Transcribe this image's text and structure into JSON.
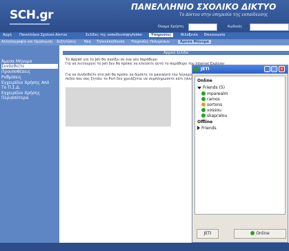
{
  "header": {
    "logo": "SCH.gr",
    "title": "ΠΑΝΕΛΛΗΝΙΟ ΣΧΟΛΙΚΟ ΔΙΚΤΥΟ",
    "subtitle": "Το Δίκτυο στην υπηρεσία της εκπαίδευσης",
    "login": {
      "username_label": "Όνομα Χρήστη",
      "password_label": "Κωδικός",
      "username_value": "",
      "password_value": ""
    }
  },
  "nav_primary": [
    {
      "label": "Αρχή"
    },
    {
      "label": "Πανελλήνιο Σχολικό Δίκτυο"
    },
    {
      "label": "Σελίδες της εκπαίδευσης"
    },
    {
      "label": "myfolder"
    },
    {
      "label": "Υπηρεσίες"
    },
    {
      "label": "Φιλοξενία"
    },
    {
      "label": "Επικοινωνία"
    }
  ],
  "nav_secondary": [
    {
      "label": "Αλληλογραφία και Οργάνωση"
    },
    {
      "label": "Συζητήσεις"
    },
    {
      "label": "Νέα"
    },
    {
      "label": "Τηλεεκπαίδευση"
    },
    {
      "label": "Υπηρεσίες Πολυμέσων"
    },
    {
      "label": "Άμεσα Μήνυμα"
    }
  ],
  "sidebar": {
    "items": [
      {
        "label": "Άμεσα Μήνυμα"
      },
      {
        "label": "Συνδεθείτε"
      },
      {
        "label": "Προυποθέσεις"
      },
      {
        "label": "Ρυθμίσεις"
      },
      {
        "label": "Εγχειρίδιο Χρήσης Από"
      },
      {
        "label": "Το Π.Σ.Δ."
      },
      {
        "label": "Εγχειρίδιο Χρήσης"
      },
      {
        "label": "Περισσότερα"
      }
    ]
  },
  "content": {
    "section_title": "Αρχική Σελίδα",
    "para1_line1": "Το Applet για το Jeti θα ανοίξει σε ένα νέο παράθυρο",
    "para1_line2": "Για να λειτουργεί το Jeti δεν θα πρέπει να κλείσετε αυτό το παράθυρο του Internet Explorer",
    "para2_line1": "Για να συνδεθείτε στο Jeti θα πρέπει να δώσετε το password του λογαριασμού σας στο παράθυρο που θα εμφανιστεί. Στο",
    "para2_line2": "πεδίο που σας ζητάει το Port δεν χρειάζεται να συμπληρώσετε κάτι (συνδέεται στο default port το 5222)"
  },
  "jeti": {
    "title": "JETI",
    "online_header": "Online",
    "group_label": "Friends (5)",
    "contacts": [
      {
        "name": "mparealm",
        "status": "online"
      },
      {
        "name": "ramos",
        "status": "online"
      },
      {
        "name": "sortons",
        "status": "away"
      },
      {
        "name": "vossou",
        "status": "online"
      },
      {
        "name": "skapralou",
        "status": "online"
      }
    ],
    "offline_header": "Offline",
    "offline_group": "Friends",
    "jeti_button": "JETI",
    "status_button": "Online"
  },
  "colors": {
    "brand_dark": "#2c4c8a",
    "brand_mid": "#3c6ab4",
    "sidebar": "#5e86c5",
    "online": "#2aa02a"
  }
}
